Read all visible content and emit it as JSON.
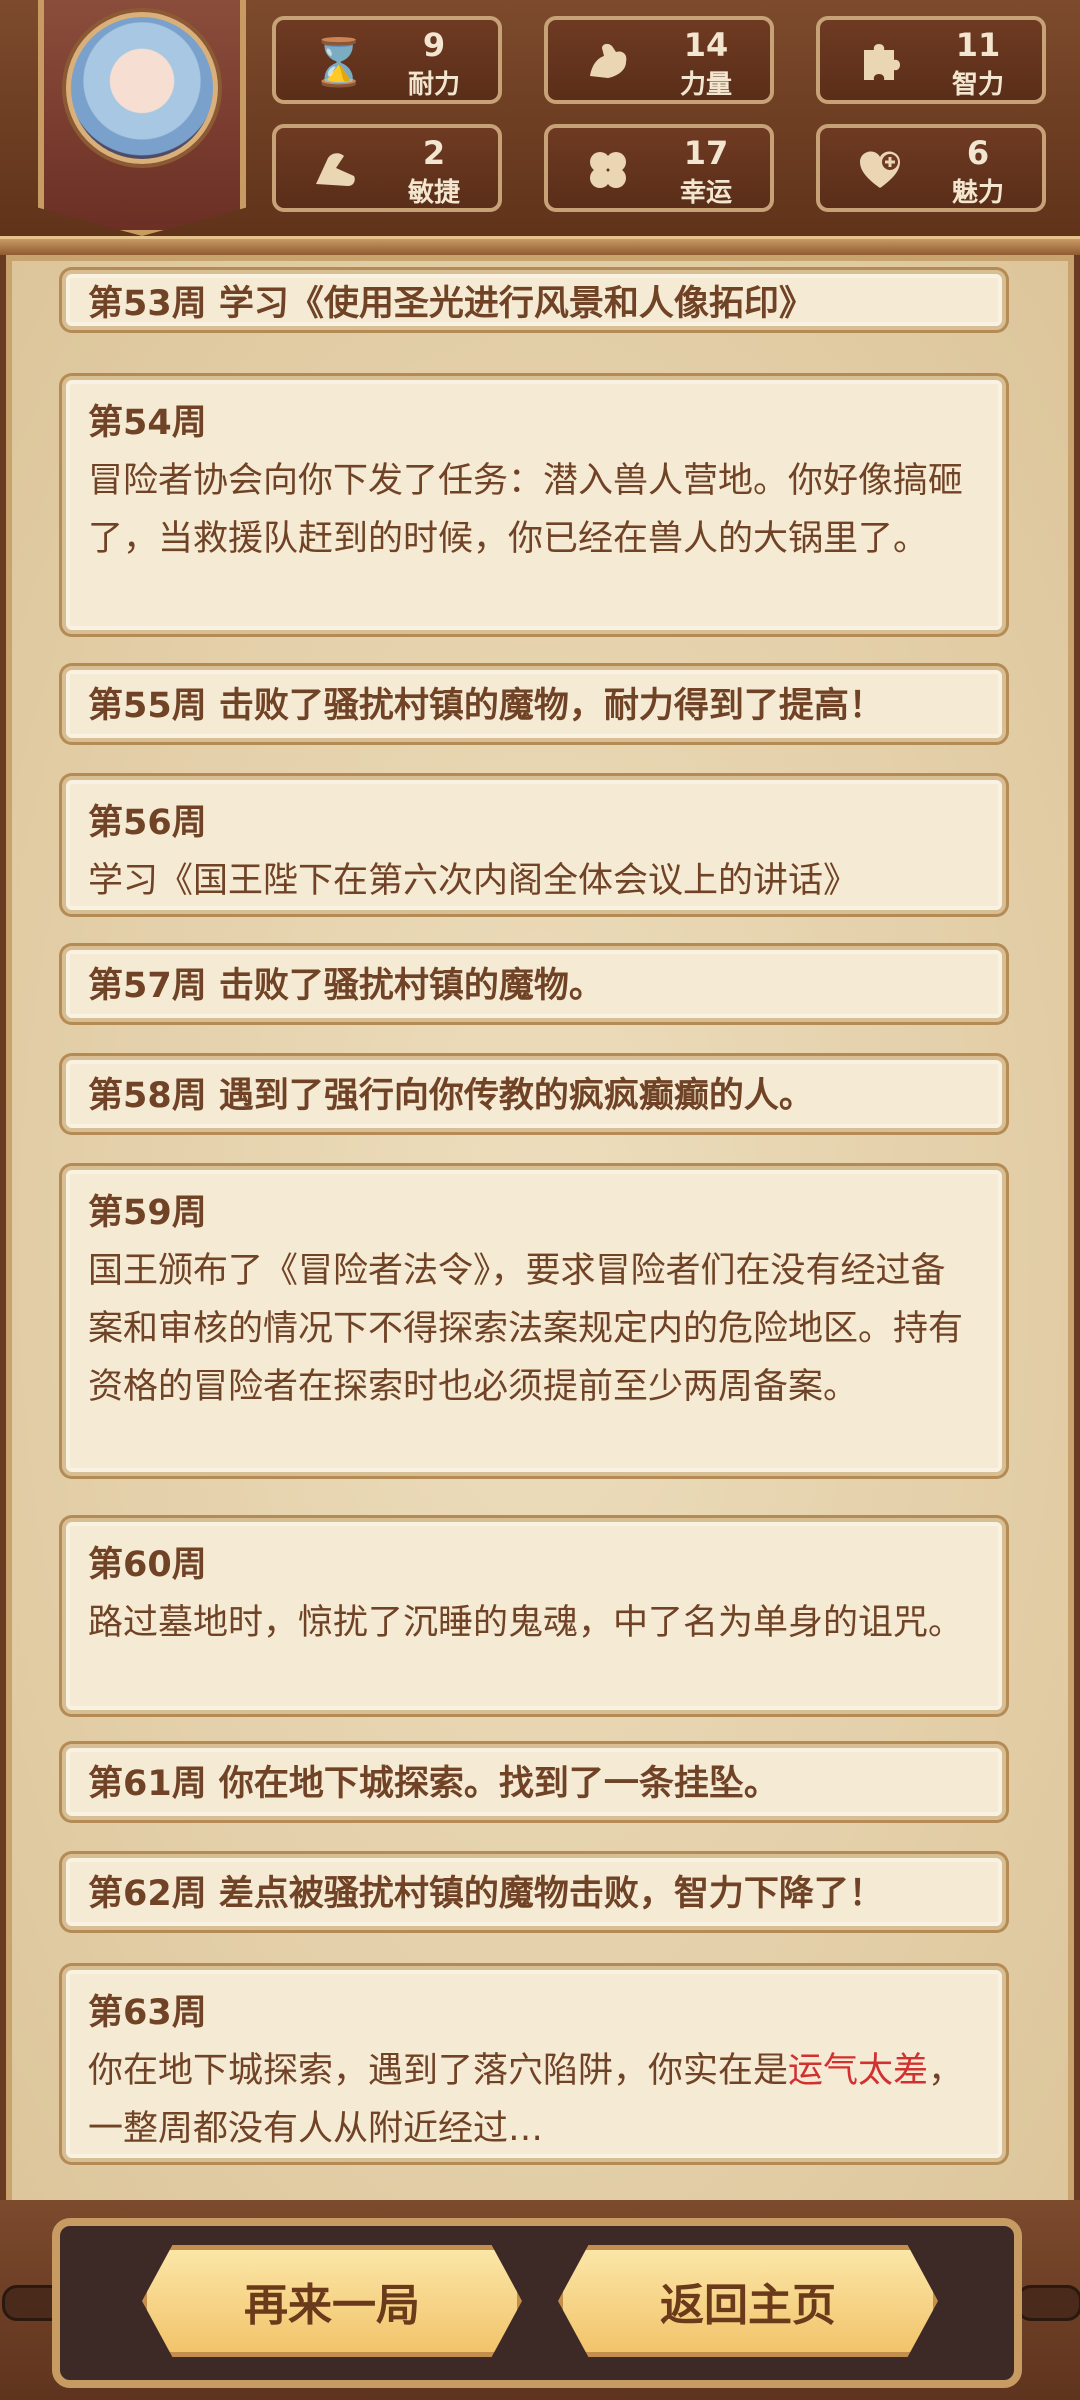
{
  "stats": [
    {
      "value": "9",
      "label": "耐力",
      "icon": "hourglass-icon"
    },
    {
      "value": "14",
      "label": "力量",
      "icon": "muscle-icon"
    },
    {
      "value": "11",
      "label": "智力",
      "icon": "puzzle-icon"
    },
    {
      "value": "2",
      "label": "敏捷",
      "icon": "boot-icon"
    },
    {
      "value": "17",
      "label": "幸运",
      "icon": "clover-icon"
    },
    {
      "value": "6",
      "label": "魅力",
      "icon": "heart-plus-icon"
    }
  ],
  "log": {
    "e53": "第53周 学习《使用圣光进行风景和人像拓印》",
    "e54_week": "第54周",
    "e54_text": "冒险者协会向你下发了任务：潜入兽人营地。你好像搞砸了，当救援队赶到的时候，你已经在兽人的大锅里了。",
    "e55": "第55周 击败了骚扰村镇的魔物，耐力得到了提高！",
    "e56_week": "第56周",
    "e56_text": "学习《国王陛下在第六次内阁全体会议上的讲话》",
    "e57": "第57周 击败了骚扰村镇的魔物。",
    "e58": "第58周 遇到了强行向你传教的疯疯癫癫的人。",
    "e59_week": "第59周",
    "e59_text": "国王颁布了《冒险者法令》，要求冒险者们在没有经过备案和审核的情况下不得探索法案规定内的危险地区。持有资格的冒险者在探索时也必须提前至少两周备案。",
    "e60_week": "第60周",
    "e60_text": "路过墓地时，惊扰了沉睡的鬼魂，中了名为单身的诅咒。",
    "e61": "第61周 你在地下城探索。找到了一条挂坠。",
    "e62": "第62周 差点被骚扰村镇的魔物击败，智力下降了！",
    "e63_week": "第63周",
    "e63_pre": "你在地下城探索，遇到了落穴陷阱，你实在是",
    "e63_hl": "运气太差",
    "e63_post": "，一整周都没有人从附近经过…"
  },
  "footer": {
    "retry_label": "再来一局",
    "home_label": "返回主页"
  }
}
